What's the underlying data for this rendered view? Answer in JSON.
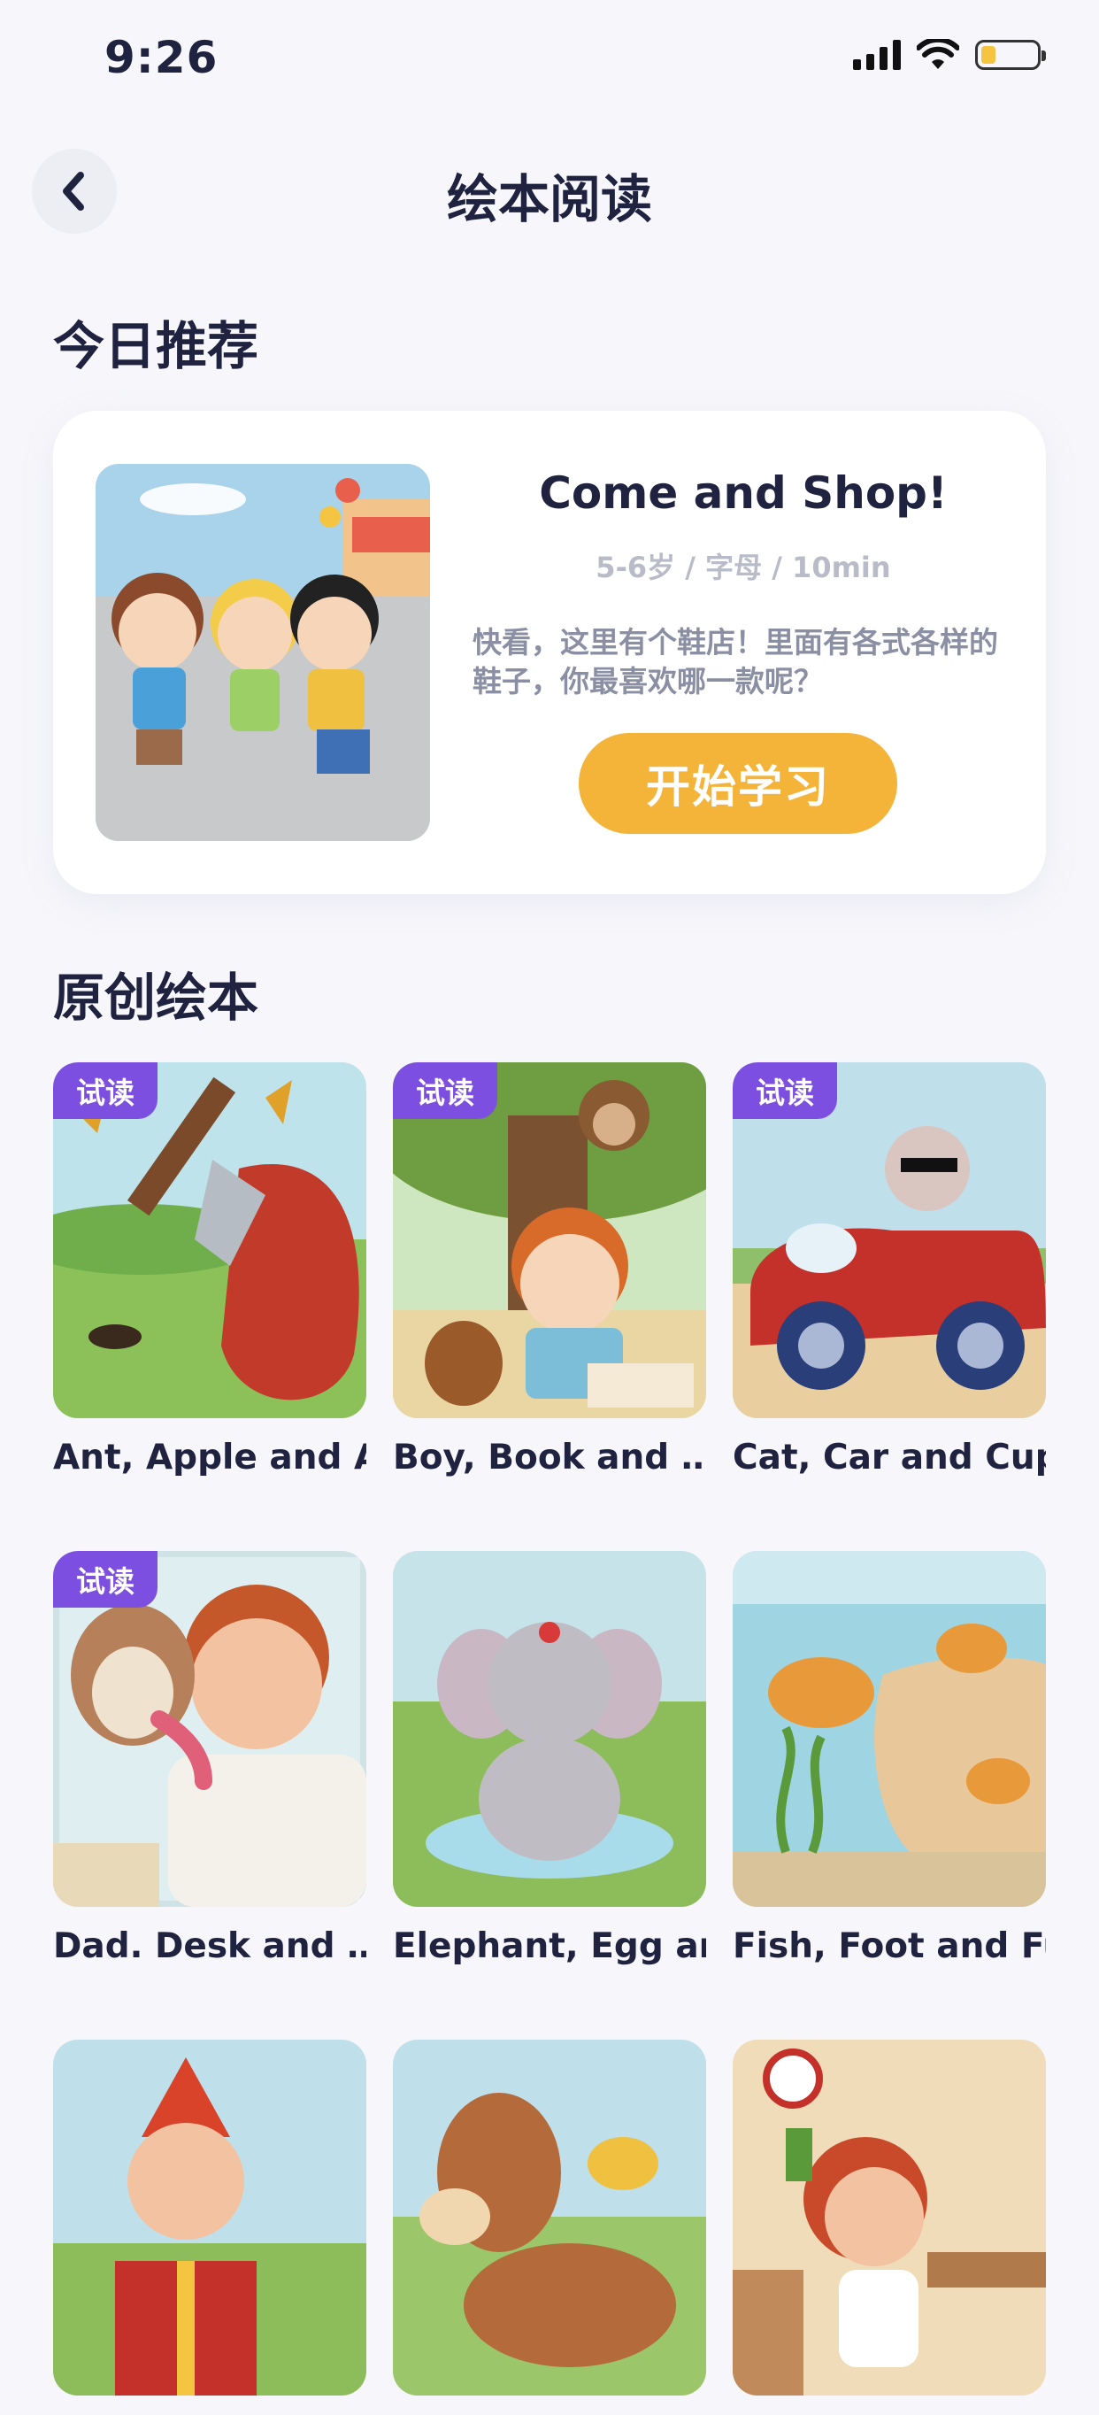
{
  "status_bar": {
    "time": "9:26"
  },
  "header": {
    "title": "绘本阅读"
  },
  "recommend": {
    "section_title": "今日推荐",
    "book": {
      "title": "Come and Shop!",
      "meta": "5-6岁 / 字母 / 10min",
      "description": "快看，这里有个鞋店！里面有各式各样的鞋子，你最喜欢哪一款呢？",
      "button_label": "开始学习"
    }
  },
  "originals": {
    "section_title": "原创绘本",
    "trial_label": "试读",
    "books": [
      {
        "title": "Ant, Apple and Ax!",
        "trial": true
      },
      {
        "title": "Boy, Book and …",
        "trial": true
      },
      {
        "title": "Cat, Car and Cup!",
        "trial": true
      },
      {
        "title": "Dad. Desk and …",
        "trial": true
      },
      {
        "title": "Elephant, Egg an…",
        "trial": false
      },
      {
        "title": "Fish, Foot and Fun!",
        "trial": false
      },
      {
        "title": "",
        "trial": false
      },
      {
        "title": "",
        "trial": false
      },
      {
        "title": "",
        "trial": false
      }
    ]
  },
  "colors": {
    "accent": "#f4b43a",
    "badge": "#7d4fe0",
    "text": "#1f2340"
  }
}
